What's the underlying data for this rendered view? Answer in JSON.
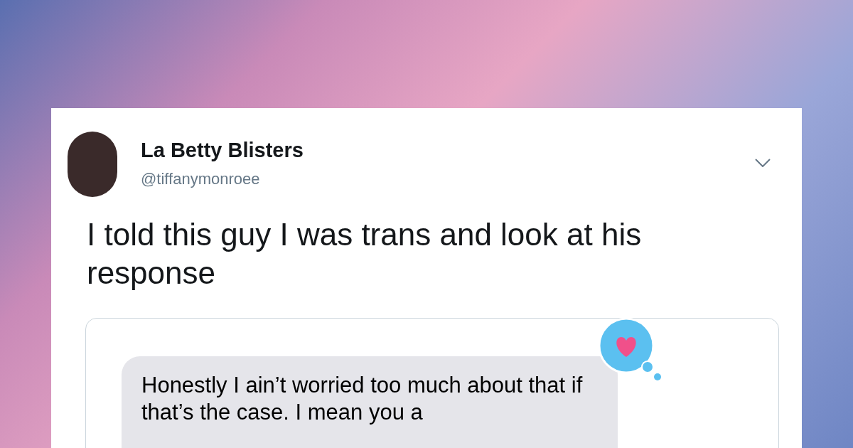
{
  "tweet": {
    "author": {
      "name": "La Betty Blisters",
      "handle": "@tiffanymonroee"
    },
    "text": "I told this guy I was trans and look at his response",
    "screenshot": {
      "message": {
        "text": "Honestly I ain’t worried too much about that if that’s the case. I mean you a"
      }
    }
  }
}
